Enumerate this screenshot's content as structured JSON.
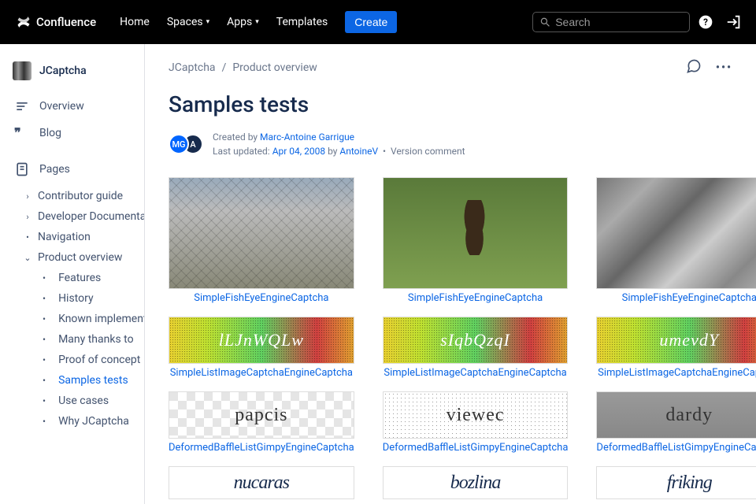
{
  "nav": {
    "product": "Confluence",
    "items": [
      "Home",
      "Spaces",
      "Apps",
      "Templates"
    ],
    "items_dropdown": [
      false,
      true,
      true,
      false
    ],
    "create": "Create",
    "search_placeholder": "Search"
  },
  "space": {
    "name": "JCaptcha"
  },
  "sidebar": {
    "overview": "Overview",
    "blog": "Blog",
    "pages": "Pages",
    "tree": [
      {
        "label": "Contributor guide",
        "hasChildren": true,
        "expanded": false
      },
      {
        "label": "Developer Documenta...",
        "hasChildren": true,
        "expanded": false
      },
      {
        "label": "Navigation",
        "hasChildren": false
      },
      {
        "label": "Product overview",
        "hasChildren": true,
        "expanded": true,
        "children": [
          {
            "label": "Features"
          },
          {
            "label": "History"
          },
          {
            "label": "Known implement..."
          },
          {
            "label": "Many thanks to"
          },
          {
            "label": "Proof of concept"
          },
          {
            "label": "Samples tests",
            "active": true
          },
          {
            "label": "Use cases"
          },
          {
            "label": "Why JCaptcha"
          }
        ]
      }
    ]
  },
  "breadcrumbs": [
    "JCaptcha",
    "Product overview"
  ],
  "page": {
    "title": "Samples tests",
    "avatars": [
      "MG",
      "A"
    ],
    "created_prefix": "Created by ",
    "created_by": "Marc-Antoine Garrigue",
    "updated_prefix": "Last updated: ",
    "updated_date": "Apr 04, 2008",
    "updated_by_prefix": " by ",
    "updated_by": "AntoineV",
    "version_comment": "Version comment"
  },
  "gallery": [
    {
      "caption": "SimpleFishEyeEngineCaptcha",
      "kind": "rail"
    },
    {
      "caption": "SimpleFishEyeEngineCaptcha",
      "kind": "horse"
    },
    {
      "caption": "SimpleFishEyeEngineCaptcha",
      "kind": "water"
    },
    {
      "caption": "SimpleListImageCaptchaEngineCaptcha",
      "kind": "noisy",
      "text": "lLJnWQLw"
    },
    {
      "caption": "SimpleListImageCaptchaEngineCaptcha",
      "kind": "noisy",
      "text": "sIqbQzqI"
    },
    {
      "caption": "SimpleListImageCaptchaEngineCaptcha",
      "kind": "noisy",
      "text": "umevdY"
    },
    {
      "caption": "DeformedBaffleListGimpyEngineCaptcha",
      "kind": "checker",
      "text": "papcis"
    },
    {
      "caption": "DeformedBaffleListGimpyEngineCaptcha",
      "kind": "speck",
      "text": "viewec"
    },
    {
      "caption": "DeformedBaffleListGimpyEngineCaptcha",
      "kind": "gray",
      "text": "dardy"
    },
    {
      "caption": "",
      "kind": "plain",
      "text": "nucaras"
    },
    {
      "caption": "",
      "kind": "plain",
      "text": "bozlina"
    },
    {
      "caption": "",
      "kind": "plain",
      "text": "friking"
    }
  ]
}
